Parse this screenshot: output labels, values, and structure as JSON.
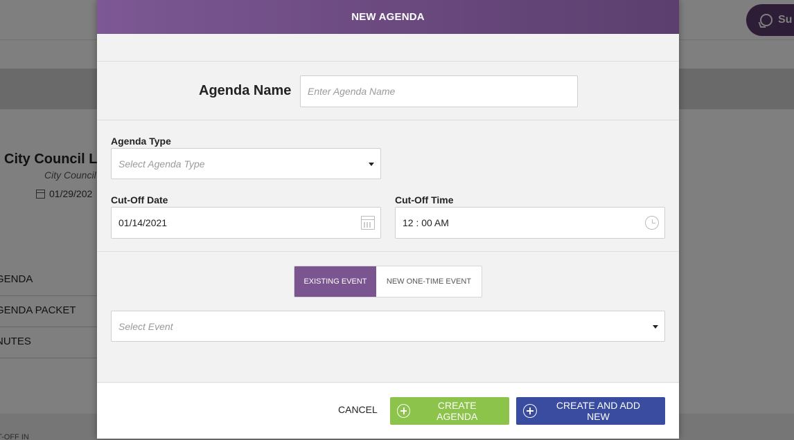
{
  "background": {
    "support_label": "Su",
    "title": "City Council Le",
    "subtitle": "City Council",
    "date": "01/29/202",
    "menu": [
      "GENDA",
      "GENDA PACKET",
      "NUTES"
    ],
    "footer_label": "T-OFF IN"
  },
  "modal": {
    "title": "NEW AGENDA",
    "agenda_name": {
      "label": "Agenda Name",
      "value": "",
      "placeholder": "Enter Agenda Name"
    },
    "agenda_type": {
      "label": "Agenda Type",
      "placeholder": "Select Agenda Type"
    },
    "cutoff_date": {
      "label": "Cut-Off Date",
      "value": "01/14/2021"
    },
    "cutoff_time": {
      "label": "Cut-Off Time",
      "value": "12 : 00 AM"
    },
    "event_toggle": {
      "existing": "EXISTING EVENT",
      "new_one_time": "NEW ONE-TIME EVENT",
      "active": "existing"
    },
    "event_select": {
      "placeholder": "Select Event"
    },
    "buttons": {
      "cancel": "CANCEL",
      "create": "CREATE AGENDA",
      "create_and_add": "CREATE AND ADD NEW"
    }
  },
  "colors": {
    "header_purple": "#6b4a80",
    "toggle_active": "#7a5590",
    "create_green": "#8cc34b",
    "create_new_blue": "#3a4ca0"
  }
}
